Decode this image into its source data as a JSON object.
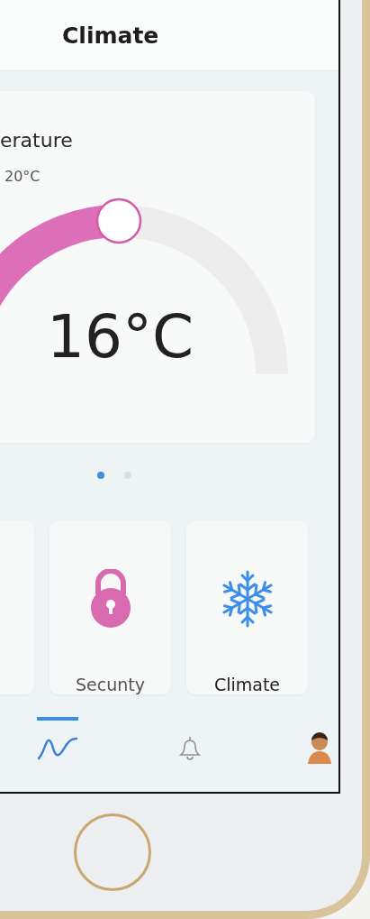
{
  "header": {
    "title": "Climate"
  },
  "temperature_card": {
    "title": "erature",
    "target": "20°C",
    "reading": "16°C",
    "level": 0.5
  },
  "pager": [
    {
      "selected": true
    },
    {
      "selected": false
    }
  ],
  "tiles": [
    {
      "kind": "blank"
    },
    {
      "kind": "lock",
      "label": "Secunty",
      "selected": false
    },
    {
      "kind": "snowflake",
      "label": "Climate",
      "selected": true
    }
  ],
  "nav": [
    {
      "kind": "chart",
      "selected": true
    },
    {
      "kind": "bell",
      "selected": false
    },
    {
      "kind": "avatar",
      "selected": false
    }
  ]
}
